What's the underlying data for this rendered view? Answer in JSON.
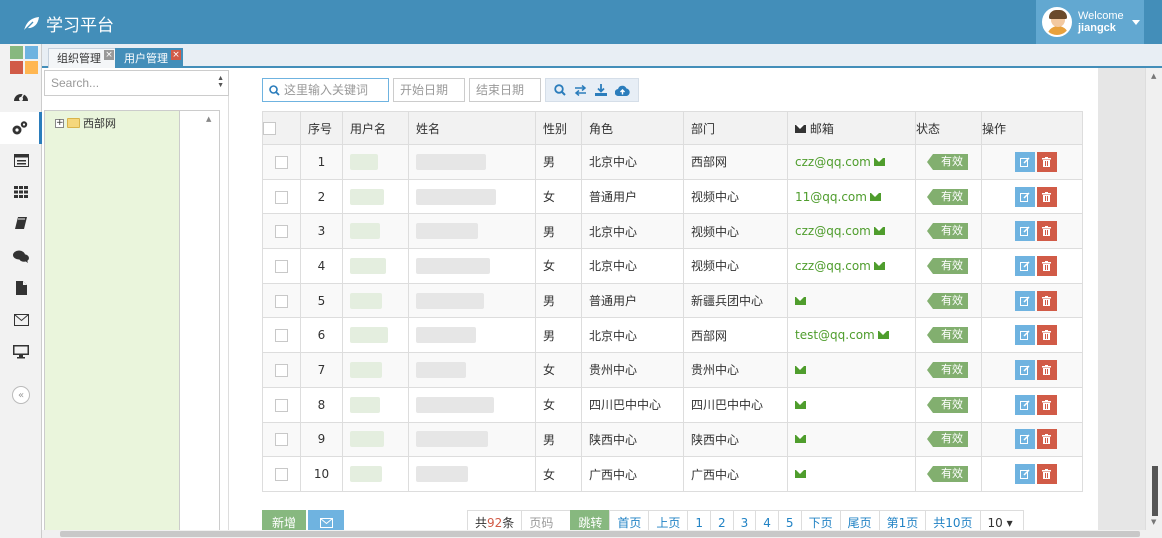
{
  "header": {
    "brand": "学习平台",
    "welcome": "Welcome",
    "username": "jiangck"
  },
  "tabs": [
    {
      "label": "组织管理",
      "close": "×"
    },
    {
      "label": "用户管理",
      "close": "×"
    }
  ],
  "tree": {
    "search_placeholder": "Search...",
    "root_node": "西部网"
  },
  "toolbar": {
    "keyword_placeholder": "这里输入关键词",
    "start_date_placeholder": "开始日期",
    "end_date_placeholder": "结束日期"
  },
  "table": {
    "headers": {
      "index": "序号",
      "username": "用户名",
      "name": "姓名",
      "gender": "性别",
      "role": "角色",
      "dept": "部门",
      "email": "邮箱",
      "status": "状态",
      "actions": "操作"
    },
    "rows": [
      {
        "index": "1",
        "gender": "男",
        "role": "北京中心",
        "dept": "西部网",
        "email": "czz@qq.com",
        "status": "有效"
      },
      {
        "index": "2",
        "gender": "女",
        "role": "普通用户",
        "dept": "视频中心",
        "email": "11@qq.com",
        "status": "有效"
      },
      {
        "index": "3",
        "gender": "男",
        "role": "北京中心",
        "dept": "视频中心",
        "email": "czz@qq.com",
        "status": "有效"
      },
      {
        "index": "4",
        "gender": "女",
        "role": "北京中心",
        "dept": "视频中心",
        "email": "czz@qq.com",
        "status": "有效"
      },
      {
        "index": "5",
        "gender": "男",
        "role": "普通用户",
        "dept": "新疆兵团中心",
        "email": "",
        "status": "有效"
      },
      {
        "index": "6",
        "gender": "男",
        "role": "北京中心",
        "dept": "西部网",
        "email": "test@qq.com",
        "status": "有效"
      },
      {
        "index": "7",
        "gender": "女",
        "role": "贵州中心",
        "dept": "贵州中心",
        "email": "",
        "status": "有效"
      },
      {
        "index": "8",
        "gender": "女",
        "role": "四川巴中中心",
        "dept": "四川巴中中心",
        "email": "",
        "status": "有效"
      },
      {
        "index": "9",
        "gender": "男",
        "role": "陕西中心",
        "dept": "陕西中心",
        "email": "",
        "status": "有效"
      },
      {
        "index": "10",
        "gender": "女",
        "role": "广西中心",
        "dept": "广西中心",
        "email": "",
        "status": "有效"
      }
    ]
  },
  "bottom": {
    "add_label": "新增",
    "total_prefix": "共",
    "total_count": "92",
    "total_suffix": "条",
    "page_input_placeholder": "页码",
    "goto_label": "跳转",
    "first": "首页",
    "prev": "上页",
    "pages": [
      "1",
      "2",
      "3",
      "4",
      "5"
    ],
    "next": "下页",
    "last": "尾页",
    "current_page": "第1页",
    "total_pages": "共10页",
    "page_size": "10 ▾"
  },
  "icons": {
    "nav": [
      "dashboard-icon",
      "cogs-icon",
      "list-icon",
      "grid-icon",
      "book-icon",
      "comments-icon",
      "file-icon",
      "envelope-icon",
      "desktop-icon"
    ]
  },
  "colors": {
    "primary": "#438eb9",
    "success": "#82af6f",
    "danger": "#d15b47",
    "info": "#6fb3e0",
    "email_green": "#4f9d2d"
  }
}
